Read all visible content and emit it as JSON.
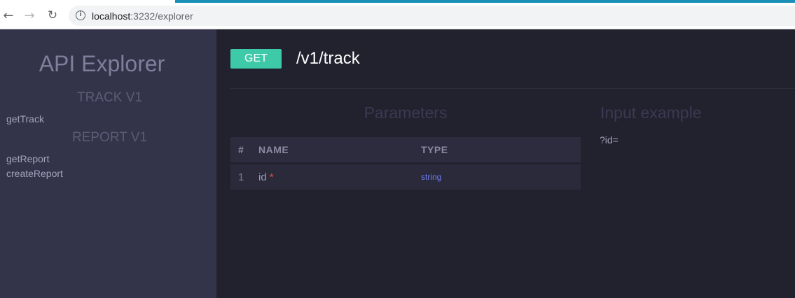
{
  "browser": {
    "url_host": "localhost",
    "url_rest": ":3232/explorer"
  },
  "sidebar": {
    "title": "API Explorer",
    "groups": [
      {
        "label": "TRACK V1",
        "items": [
          "getTrack"
        ]
      },
      {
        "label": "REPORT V1",
        "items": [
          "getReport",
          "createReport"
        ]
      }
    ]
  },
  "endpoint": {
    "method": "GET",
    "path": "/v1/track",
    "method_color": "#3ec9a9"
  },
  "parameters": {
    "title": "Parameters",
    "columns": [
      "#",
      "NAME",
      "TYPE"
    ],
    "rows": [
      {
        "num": "1",
        "name": "id",
        "required_mark": "*",
        "type": "string"
      }
    ]
  },
  "example": {
    "title": "Input example",
    "text": "?id="
  },
  "icons": {
    "back": "arrow-left-icon",
    "forward": "arrow-right-icon",
    "reload": "reload-icon",
    "info": "info-icon"
  }
}
